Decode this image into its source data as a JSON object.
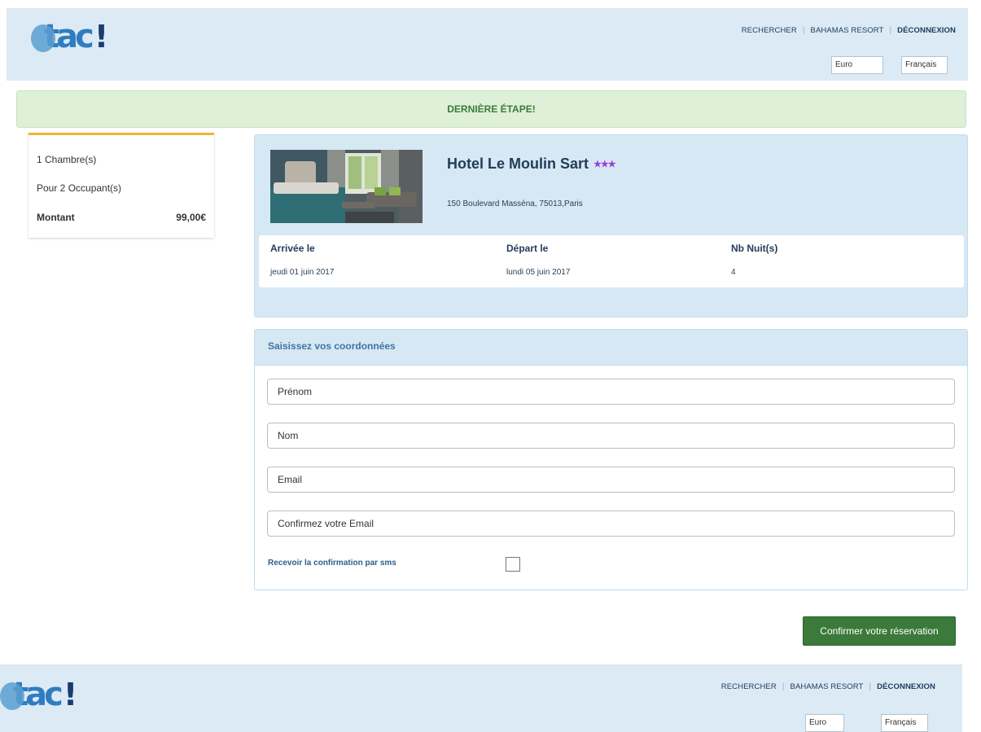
{
  "header": {
    "nav": {
      "search": "RECHERCHER",
      "hotel": "BAHAMAS RESORT",
      "logout": "DÉCONNEXION"
    },
    "currency": "Euro",
    "language": "Français",
    "logo": {
      "word": "tac",
      "mark": "!"
    }
  },
  "banner": {
    "text": "DERNIÈRE ÉTAPE!"
  },
  "summary": {
    "rooms": "1 Chambre(s)",
    "occupants": "Pour 2 Occupant(s)",
    "amount_label": "Montant",
    "amount_value": "99,00€"
  },
  "hotel": {
    "name": "Hotel Le Moulin Sart",
    "stars": "★★★",
    "address": "150 Boulevard Masséna, 75013,Paris",
    "arrival_label": "Arrivée le",
    "arrival_value": "jeudi 01 juin 2017",
    "departure_label": "Départ le",
    "departure_value": "lundi 05 juin 2017",
    "nights_label": "Nb Nuit(s)",
    "nights_value": "4"
  },
  "form": {
    "title": "Saisissez vos coordonnées",
    "firstname_placeholder": "Prénom",
    "lastname_placeholder": "Nom",
    "email_placeholder": "Email",
    "email_confirm_placeholder": "Confirmez votre Email",
    "sms_label": "Recevoir la confirmation par sms"
  },
  "actions": {
    "confirm_label": "Confirmer votre réservation"
  },
  "colors": {
    "header_bg": "#dbeaf5",
    "banner_bg": "#def0d8",
    "banner_text": "#3c7a3c",
    "summary_accent": "#efb535",
    "stars": "#9a3fd8",
    "confirm_button": "#3b7a3a"
  }
}
